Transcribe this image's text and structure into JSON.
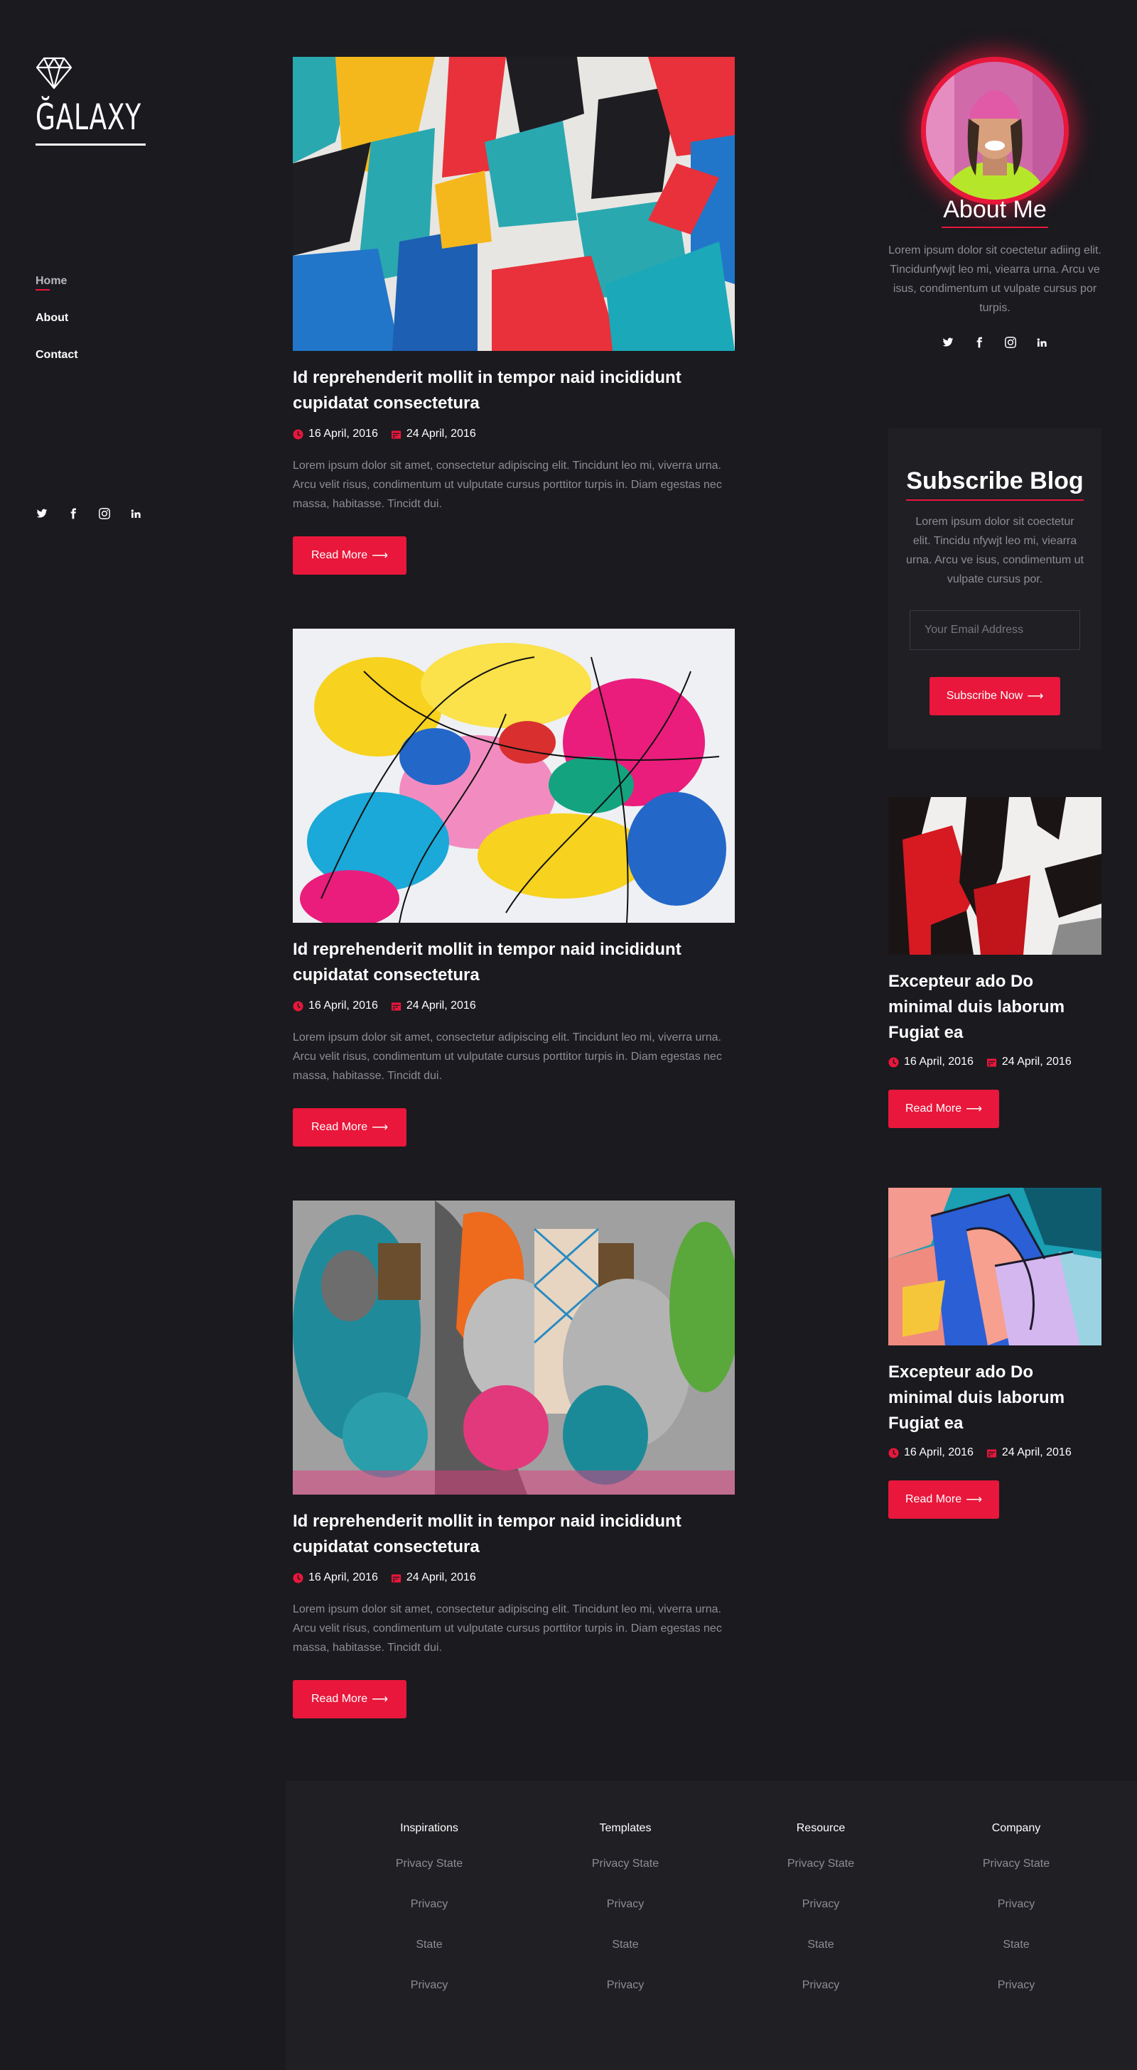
{
  "site": {
    "logo_text": "ĞALAXY"
  },
  "nav": {
    "items": [
      {
        "label": "Home"
      },
      {
        "label": "About"
      },
      {
        "label": "Contact"
      }
    ]
  },
  "social_icons": [
    "twitter-icon",
    "facebook-icon",
    "instagram-icon",
    "linkedin-icon"
  ],
  "posts": [
    {
      "title": "Id reprehenderit mollit in tempor naid incididunt cupidatat consectetura",
      "date_posted": "16 April, 2016",
      "date_updated": "24 April, 2016",
      "excerpt": "Lorem ipsum dolor sit amet, consectetur adipiscing elit. Tincidunt leo mi, viverra urna. Arcu velit risus, condimentum ut vulputate cursus porttitor turpis in. Diam egestas nec massa, habitasse. Tincidt dui.",
      "button": "Read More"
    },
    {
      "title": "Id reprehenderit mollit in tempor naid incididunt cupidatat consectetura",
      "date_posted": "16 April, 2016",
      "date_updated": "24 April, 2016",
      "excerpt": "Lorem ipsum dolor sit amet, consectetur adipiscing elit. Tincidunt leo mi, viverra urna. Arcu velit risus, condimentum ut vulputate cursus porttitor turpis in. Diam egestas nec massa, habitasse. Tincidt dui.",
      "button": "Read More"
    },
    {
      "title": "Id reprehenderit mollit in tempor naid incididunt cupidatat consectetura",
      "date_posted": "16 April, 2016",
      "date_updated": "24 April, 2016",
      "excerpt": "Lorem ipsum dolor sit amet, consectetur adipiscing elit. Tincidunt leo mi, viverra urna. Arcu velit risus, condimentum ut vulputate cursus porttitor turpis in. Diam egestas nec massa, habitasse. Tincidt dui.",
      "button": "Read More"
    }
  ],
  "about": {
    "title": "About Me",
    "text": "Lorem ipsum dolor sit coectetur adiing elit. Tincidunfywjt leo mi, viearra urna. Arcu ve isus, condimentum ut vulpate cursus por turpis."
  },
  "subscribe": {
    "title": "Subscribe Blog",
    "text": "Lorem ipsum dolor sit coectetur elit. Tincidu nfywjt leo mi, viearra urna. Arcu ve isus, condimentum ut vulpate cursus por.",
    "placeholder": "Your Email Address",
    "button": "Subscribe Now"
  },
  "side_posts": [
    {
      "title": "Excepteur ado Do minimal duis laborum Fugiat ea",
      "date_posted": "16 April, 2016",
      "date_updated": "24 April, 2016",
      "button": "Read More"
    },
    {
      "title": "Excepteur ado Do minimal duis laborum Fugiat ea",
      "date_posted": "16 April, 2016",
      "date_updated": "24 April, 2016",
      "button": "Read More"
    }
  ],
  "footer": {
    "columns": [
      {
        "heading": "Inspirations",
        "links": [
          "Privacy State",
          "Privacy",
          "State",
          "Privacy"
        ]
      },
      {
        "heading": "Templates",
        "links": [
          "Privacy State",
          "Privacy",
          "State",
          "Privacy"
        ]
      },
      {
        "heading": "Resource",
        "links": [
          "Privacy State",
          "Privacy",
          "State",
          "Privacy"
        ]
      },
      {
        "heading": "Company",
        "links": [
          "Privacy State",
          "Privacy",
          "State",
          "Privacy"
        ]
      }
    ]
  },
  "colors": {
    "accent": "#e8173b",
    "background": "#1a1a1f",
    "panel": "#1f1f24",
    "muted_text": "#8d8d95"
  }
}
